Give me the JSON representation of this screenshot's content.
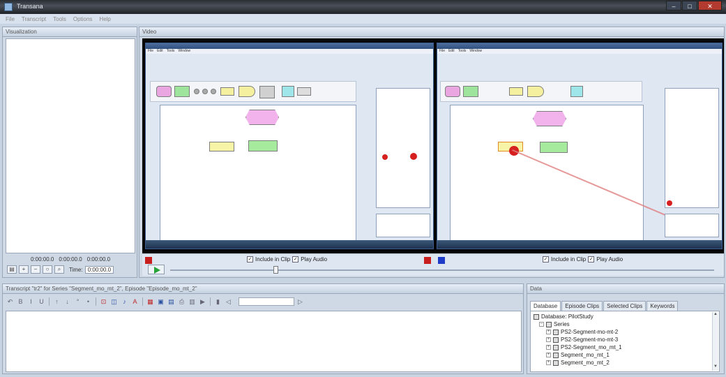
{
  "window": {
    "title": "Transana"
  },
  "menu": [
    "File",
    "Transcript",
    "Tools",
    "Options",
    "Help"
  ],
  "visualization": {
    "title": "Visualization",
    "timecodes": [
      "0:00:00.0",
      "0:00:00.0",
      "0:00:00.0"
    ],
    "time_label": "Time:",
    "time_value": "0:00:00.0"
  },
  "video": {
    "title": "Video",
    "include_in_clip": "Include in Clip",
    "play_audio": "Play Audio"
  },
  "transcript": {
    "title": "Transcript \"tr2\" for Series \"Segment_mo_mt_2\", Episode \"Episode_mo_mt_2\""
  },
  "data": {
    "title": "Data",
    "tabs": [
      "Database",
      "Episode Clips",
      "Selected Clips",
      "Keywords"
    ],
    "database_label": "Database: PilotStudy",
    "series_label": "Series",
    "series_items": [
      "PS2-Segment-mo-mt-2",
      "PS2-Segment-mo-mt-3",
      "PS2-Segment_mo_mt_1",
      "Segment_mo_mt_1",
      "Segment_mo_mt_2"
    ]
  },
  "colors": {
    "marker_red": "#c81e1e",
    "marker_blue": "#1e3cc8",
    "play_green": "#27a33a"
  }
}
